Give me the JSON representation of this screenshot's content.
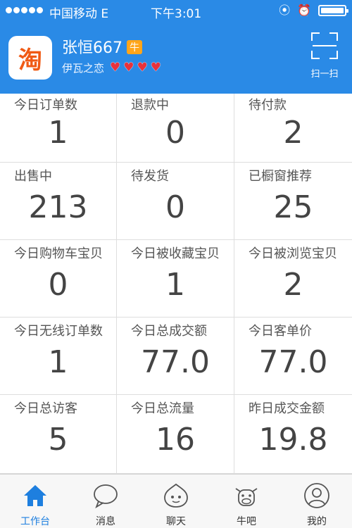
{
  "status_bar": {
    "carrier": "中国移动  E",
    "time": "下午3:01"
  },
  "header": {
    "logo_text": "淘",
    "user_name": "张恒667",
    "user_badge": "牛",
    "shop_name": "伊瓦之恋",
    "heart_count": 4,
    "scan_label": "扫一扫"
  },
  "stats": [
    {
      "label": "今日订单数",
      "value": "1"
    },
    {
      "label": "退款中",
      "value": "0"
    },
    {
      "label": "待付款",
      "value": "2"
    },
    {
      "label": "出售中",
      "value": "213"
    },
    {
      "label": "待发货",
      "value": "0"
    },
    {
      "label": "已橱窗推荐",
      "value": "25"
    },
    {
      "label": "今日购物车宝贝",
      "value": "0"
    },
    {
      "label": "今日被收藏宝贝",
      "value": "1"
    },
    {
      "label": "今日被浏览宝贝",
      "value": "2"
    },
    {
      "label": "今日无线订单数",
      "value": "1"
    },
    {
      "label": "今日总成交额",
      "value": "77.0"
    },
    {
      "label": "今日客单价",
      "value": "77.0"
    },
    {
      "label": "今日总访客",
      "value": "5"
    },
    {
      "label": "今日总流量",
      "value": "16"
    },
    {
      "label": "昨日成交金额",
      "value": "19.8"
    }
  ],
  "tabbar": {
    "tabs": [
      {
        "label": "工作台",
        "icon": "home-icon",
        "active": true
      },
      {
        "label": "消息",
        "icon": "message-icon",
        "active": false
      },
      {
        "label": "聊天",
        "icon": "chat-icon",
        "active": false
      },
      {
        "label": "牛吧",
        "icon": "cow-icon",
        "active": false
      },
      {
        "label": "我的",
        "icon": "profile-icon",
        "active": false
      }
    ]
  },
  "colors": {
    "header_bg": "#2a8ae6",
    "accent": "#1e7fdf",
    "heart": "#e8323c",
    "badge": "#ffa51a",
    "logo": "#f05a14"
  }
}
